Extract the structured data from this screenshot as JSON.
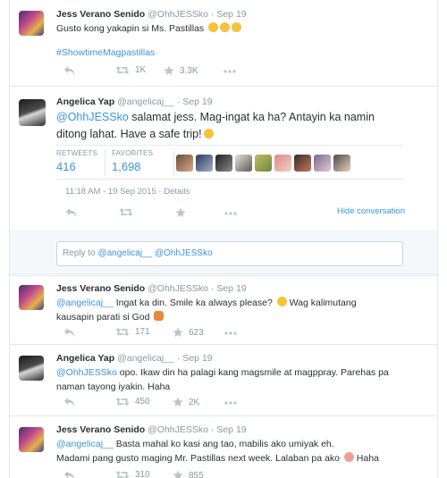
{
  "tweets": [
    {
      "name": "Jess Verano Senido",
      "handle": "@OhhJESSko",
      "dot": "·",
      "date": "Sep 19",
      "text": "Gusto kong yakapin si Ms. Pastillas",
      "hashtag": "#ShowtimeMagpastillas",
      "retweets": "1K",
      "favorites": "3.3K"
    },
    {
      "name": "Angelica Yap",
      "handle": "@angelicaj__",
      "dot": "·",
      "date": "Sep 19",
      "mention": "@OhhJESSko",
      "text": " salamat jess. Mag-ingat ka ha? Antayin ka namin ditong lahat. Have a safe trip!",
      "retweets_label": "RETWEETS",
      "retweets": "416",
      "favorites_label": "FAVORITES",
      "favorites": "1,698",
      "timestamp": "11:18 AM - 19 Sep 2015 · Details",
      "hide_conversation": "Hide conversation"
    },
    {
      "name": "Jess Verano Senido",
      "handle": "@OhhJESSko",
      "dot": "·",
      "date": "Sep 19",
      "mention": "@angelicaj__",
      "text_line1": " Ingat ka din. Smile ka always please?",
      "text_line1b": " Wag kalimutang",
      "text_line2": "kausapin parati si God",
      "retweets": "171",
      "favorites": "623"
    },
    {
      "name": "Angelica Yap",
      "handle": "@angelicaj__",
      "dot": "·",
      "date": "Sep 19",
      "mention": "@OhhJESSko",
      "text_line1": " opo. Ikaw din ha palagi kang magsmile at magppray. Parehas pa",
      "text_line2": "naman tayong iyakin. Haha",
      "retweets": "450",
      "favorites": "2K"
    },
    {
      "name": "Jess Verano Senido",
      "handle": "@OhhJESSko",
      "dot": "·",
      "date": "Sep 19",
      "mention": "@angelicaj__",
      "text_line1": " Basta mahal ko kasi ang tao, mabilis ako umiyak eh.",
      "text_line2": "Madami pang gusto maging Mr. Pastillas next week. Lalaban pa ako",
      "text_line2_end": " Haha",
      "retweets": "310",
      "favorites": "855"
    }
  ],
  "reply_box": {
    "prefix": "Reply to ",
    "mention1": "@angelicaj__",
    "mention2": "@OhhJESSko"
  },
  "icons": [
    "reply-icon",
    "retweet-icon",
    "favorite-star-icon",
    "more-icon"
  ],
  "colors": {
    "link": "#3b94d9",
    "muted": "#8899a6",
    "text": "#292f33",
    "border": "#e1e8ed"
  }
}
